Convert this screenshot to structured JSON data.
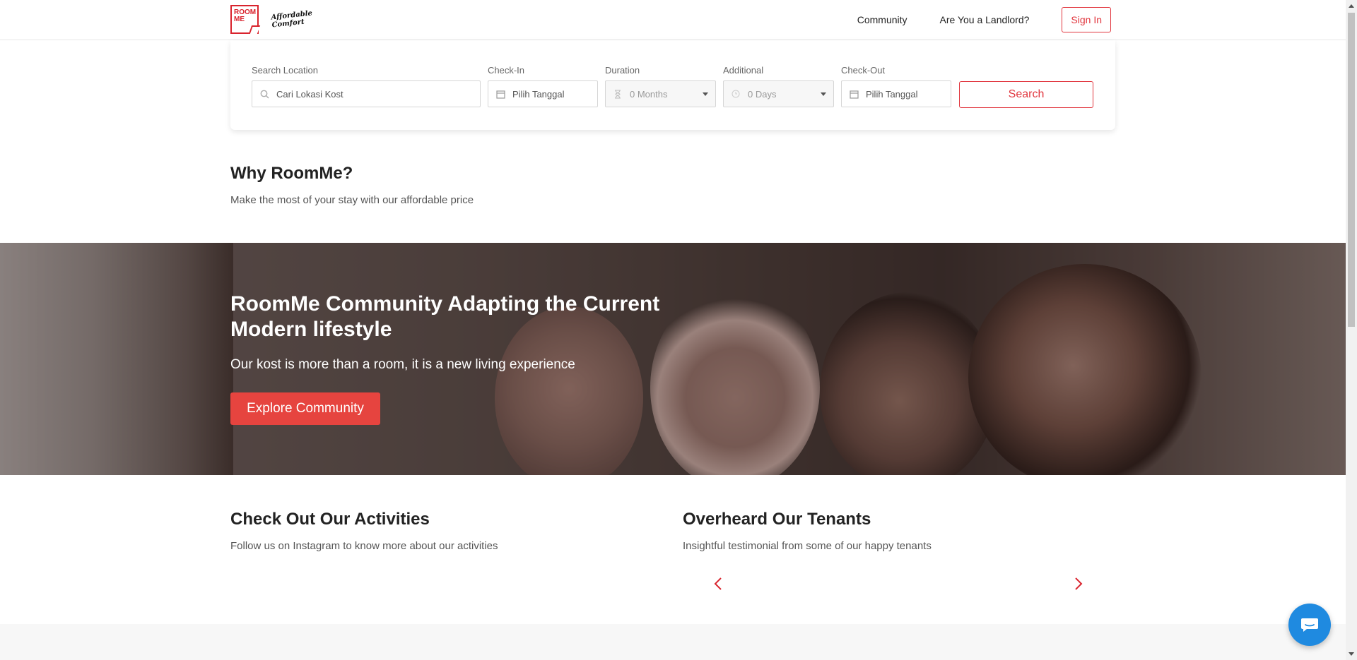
{
  "header": {
    "logo_text": "ROOM ME",
    "logo_tagline_1": "Affordable",
    "logo_tagline_2": "Comfort",
    "nav": [
      "Community",
      "Are You a Landlord?"
    ],
    "sign_in": "Sign In"
  },
  "search": {
    "location_label": "Search Location",
    "location_placeholder": "Cari Lokasi Kost",
    "checkin_label": "Check-In",
    "checkin_value": "Pilih Tanggal",
    "duration_label": "Duration",
    "duration_value": "0 Months",
    "additional_label": "Additional",
    "additional_value": "0 Days",
    "checkout_label": "Check-Out",
    "checkout_value": "Pilih Tanggal",
    "button": "Search"
  },
  "why": {
    "title": "Why RoomMe?",
    "subtitle": "Make the most of your stay with our affordable price"
  },
  "hero": {
    "title": "RoomMe Community Adapting the Current Modern lifestyle",
    "subtitle": "Our kost is more than a room, it is a new living experience",
    "button": "Explore Community"
  },
  "activities": {
    "title": "Check Out Our Activities",
    "subtitle": "Follow us on Instagram to know more about our activities"
  },
  "tenants": {
    "title": "Overheard Our Tenants",
    "subtitle": "Insightful testimonial from some of our happy tenants"
  },
  "colors": {
    "brand_red": "#e1353d",
    "chat_blue": "#1f8ae0"
  }
}
